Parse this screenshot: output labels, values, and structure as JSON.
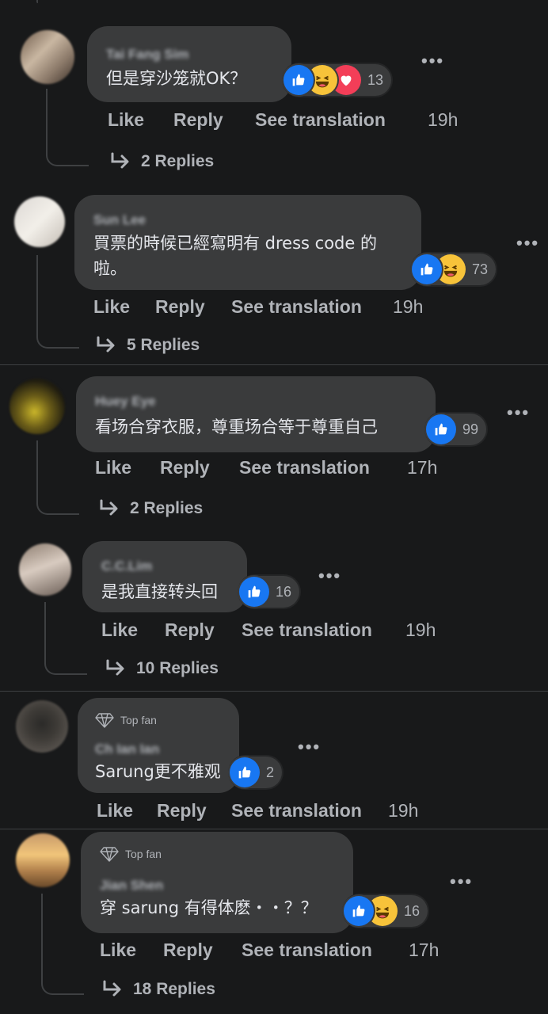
{
  "actions": {
    "like": "Like",
    "reply": "Reply",
    "translate": "See translation"
  },
  "comments": [
    {
      "author": "Tai Fang Sim",
      "text1": "但是穿沙笼就OK？",
      "text2": "",
      "count": "13",
      "time": "19h",
      "replies": "2 Replies",
      "reactions": [
        "like",
        "haha",
        "love"
      ]
    },
    {
      "author": "Sun Lee",
      "text1": "買票的時候已經寫明有 dress code 的",
      "text2": "啦。",
      "count": "73",
      "time": "19h",
      "replies": "5 Replies",
      "reactions": [
        "like",
        "haha"
      ]
    },
    {
      "author": "Huey Eye",
      "text1": "看场合穿衣服，尊重场合等于尊重自己",
      "text2": "",
      "count": "99",
      "time": "17h",
      "replies": "2 Replies",
      "reactions": [
        "like"
      ]
    },
    {
      "author": "C.C.Lim",
      "text1": "是我直接转头回",
      "text2": "",
      "count": "16",
      "time": "19h",
      "replies": "10 Replies",
      "reactions": [
        "like"
      ]
    },
    {
      "badge": "Top fan",
      "author": "Ch Ian Ian",
      "text1": "Sarung更不雅观",
      "text2": "",
      "count": "2",
      "time": "19h",
      "replies": "",
      "reactions": [
        "like"
      ]
    },
    {
      "badge": "Top fan",
      "author": "Jian Shen",
      "text1": "穿 sarung 有得体麽・・？？",
      "text2": "",
      "count": "16",
      "time": "17h",
      "replies": "18 Replies",
      "reactions": [
        "like",
        "haha"
      ]
    }
  ],
  "icons": {
    "more": "more-options-icon",
    "reply_arrow": "reply-arrow-icon",
    "badge": "diamond-badge-icon"
  },
  "colors": {
    "background": "#18191a",
    "bubble": "#3a3b3c",
    "like": "#1877f2",
    "haha": "#f7c33a",
    "love": "#f33e58"
  }
}
